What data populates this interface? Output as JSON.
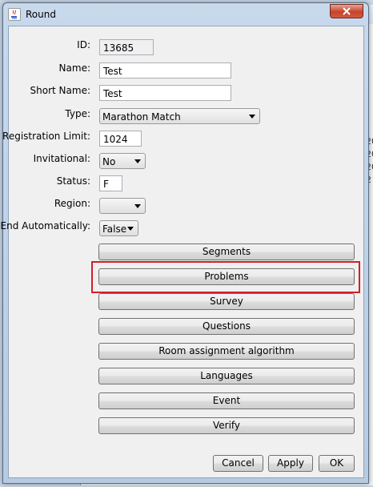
{
  "window": {
    "title": "Round"
  },
  "background": {
    "right_column": [
      "20",
      "20",
      "20",
      "2"
    ]
  },
  "form": {
    "id_label": "ID:",
    "id_value": "13685",
    "name_label": "Name:",
    "name_value": "Test",
    "short_name_label": "Short Name:",
    "short_name_value": "Test",
    "type_label": "Type:",
    "type_value": "Marathon Match",
    "registration_limit_label": "Registration Limit:",
    "registration_limit_value": "1024",
    "invitational_label": "Invitational:",
    "invitational_value": "No",
    "status_label": "Status:",
    "status_value": "F",
    "region_label": "Region:",
    "region_value": "",
    "end_automatically_label": "End Automatically:",
    "end_automatically_value": "False"
  },
  "buttons": {
    "segments": "Segments",
    "problems": "Problems",
    "survey": "Survey",
    "questions": "Questions",
    "room_assignment": "Room assignment algorithm",
    "languages": "Languages",
    "event": "Event",
    "verify": "Verify"
  },
  "footer": {
    "cancel": "Cancel",
    "apply": "Apply",
    "ok": "OK"
  },
  "highlight_color": "#d0202a"
}
